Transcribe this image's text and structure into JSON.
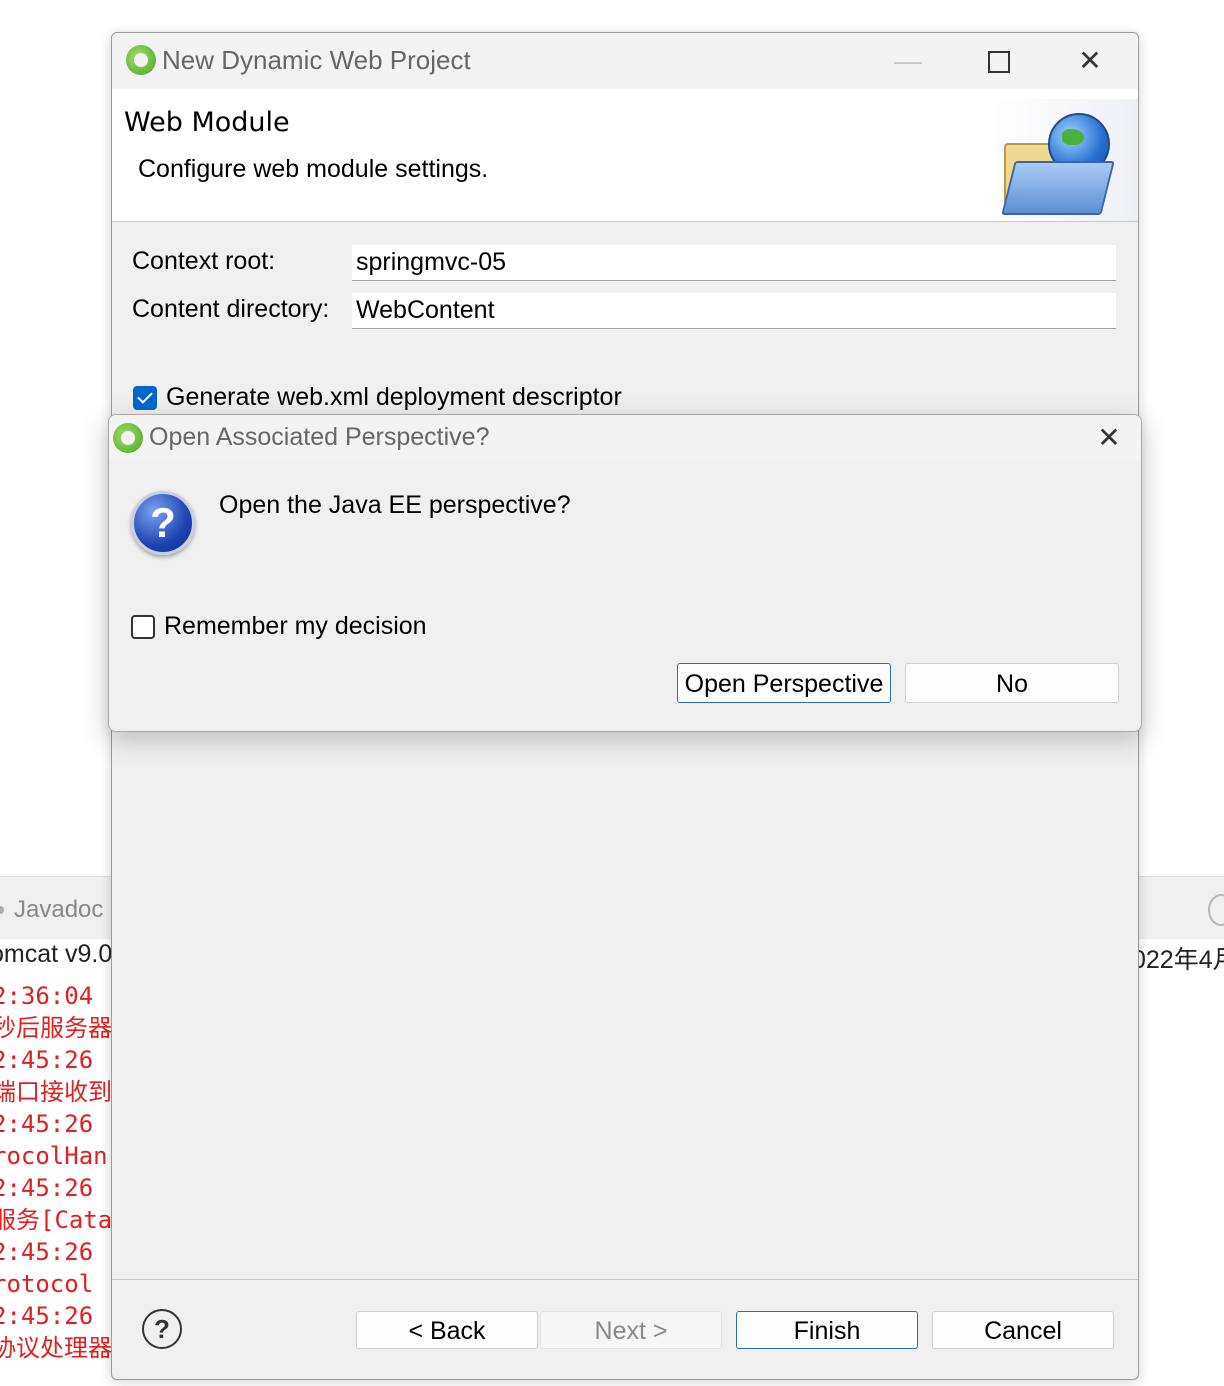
{
  "background": {
    "tab_label": "Javadoc",
    "console_title": "omcat v9.0",
    "console_title_right": "022年4月",
    "console_lines": [
      "  2:36:04",
      " 秒后服务器",
      "  2:45:26",
      " 端口接收到",
      "  2:45:26",
      " rocolHan",
      "  2:45:26",
      " 服务[Cata",
      "  2:45:26",
      " rotocol",
      "  2:45:26",
      " 协议处理器"
    ]
  },
  "wizard": {
    "title": "New Dynamic Web Project",
    "minimize_glyph": "—",
    "close_glyph": "✕",
    "banner": {
      "title": "Web Module",
      "description": "Configure web module settings."
    },
    "context_root": {
      "label": "Context root:",
      "value": "springmvc-05"
    },
    "content_directory": {
      "label": "Content directory:",
      "value": "WebContent"
    },
    "generate_webxml": {
      "label": "Generate web.xml deployment descriptor",
      "checked": true
    },
    "help_glyph": "?",
    "buttons": {
      "back": "< Back",
      "next": "Next >",
      "finish": "Finish",
      "cancel": "Cancel"
    }
  },
  "dialog": {
    "title": "Open Associated Perspective?",
    "close_glyph": "✕",
    "question_glyph": "?",
    "message": "Open the Java EE perspective?",
    "remember": {
      "label": "Remember my decision",
      "checked": false
    },
    "buttons": {
      "open": "Open Perspective",
      "no": "No"
    }
  }
}
